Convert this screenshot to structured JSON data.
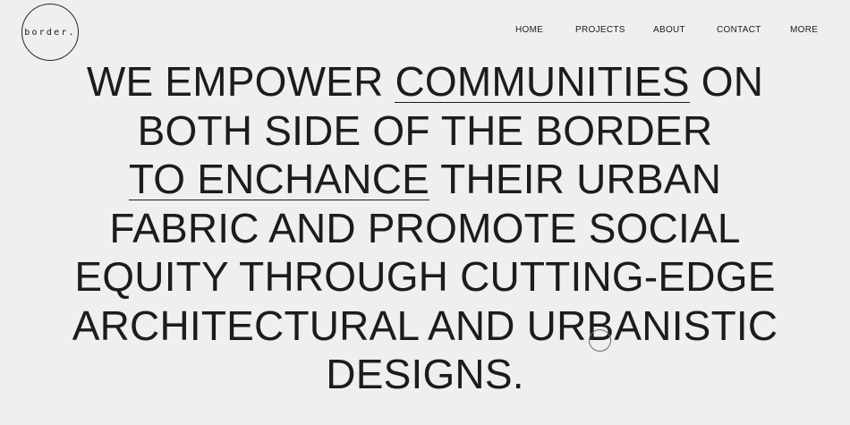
{
  "logo": {
    "text": "border."
  },
  "nav": {
    "items": [
      {
        "label": "HOME"
      },
      {
        "label": "PROJECTS"
      },
      {
        "label": "ABOUT"
      },
      {
        "label": "CONTACT"
      },
      {
        "label": "MORE"
      }
    ]
  },
  "hero": {
    "line1_a": "WE EMPOWER ",
    "line1_link": "COMMUNITIES",
    "line1_b": " ON",
    "line2": "BOTH SIDE OF THE BORDER",
    "line3_link": "TO ENCHANCE",
    "line3_b": " THEIR URBAN",
    "line4": "FABRIC AND PROMOTE SOCIAL",
    "line5": "EQUITY THROUGH CUTTING-EDGE",
    "line6": "ARCHITECTURAL AND URBANISTIC",
    "line7": "DESIGNS."
  },
  "icons": {
    "cursor": "circle-cursor-icon"
  }
}
